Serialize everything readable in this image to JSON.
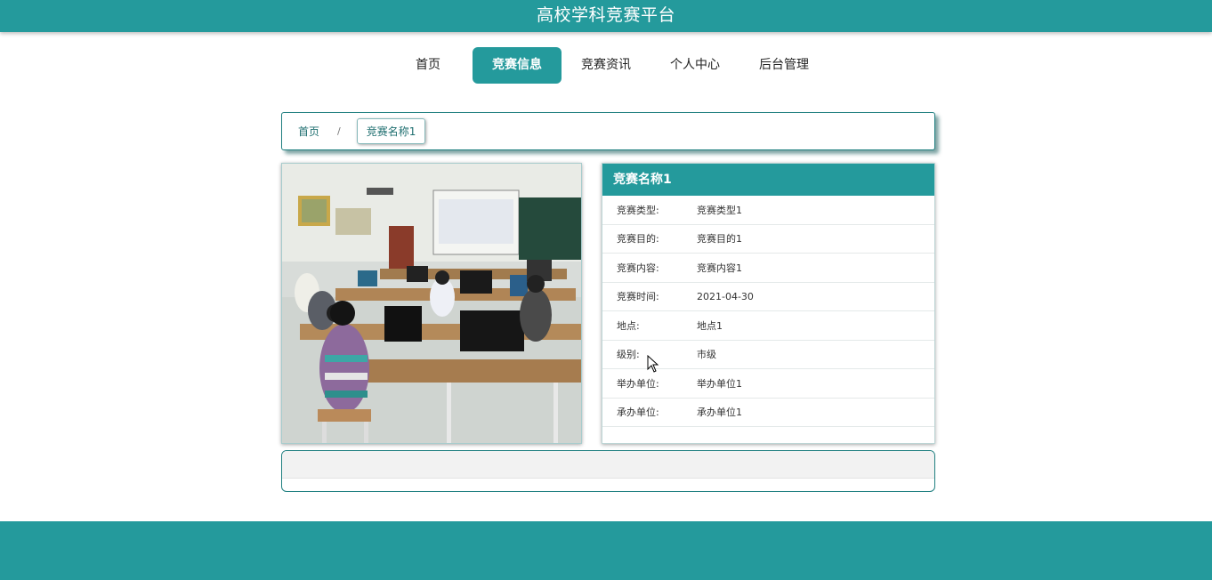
{
  "header": {
    "title": "高校学科竞赛平台"
  },
  "nav": {
    "items": [
      {
        "label": "首页"
      },
      {
        "label": "竞赛信息",
        "active": true
      },
      {
        "label": "竞赛资讯"
      },
      {
        "label": "个人中心"
      },
      {
        "label": "后台管理"
      }
    ]
  },
  "breadcrumb": {
    "home": "首页",
    "separator": "/",
    "current": "竞赛名称1"
  },
  "photo": {
    "alt_icon": "classroom-photo"
  },
  "info": {
    "title": "竞赛名称1",
    "rows": [
      {
        "label": "竞赛类型:",
        "value": "竞赛类型1"
      },
      {
        "label": "竞赛目的:",
        "value": "竞赛目的1"
      },
      {
        "label": "竞赛内容:",
        "value": "竞赛内容1"
      },
      {
        "label": "竞赛时间:",
        "value": "2021-04-30"
      },
      {
        "label": "地点:",
        "value": "地点1"
      },
      {
        "label": "级别:",
        "value": "市级"
      },
      {
        "label": "举办单位:",
        "value": "举办单位1"
      },
      {
        "label": "承办单位:",
        "value": "承办单位1"
      }
    ]
  },
  "colors": {
    "primary": "#249a9c",
    "primary_dark": "#1f7f80"
  }
}
